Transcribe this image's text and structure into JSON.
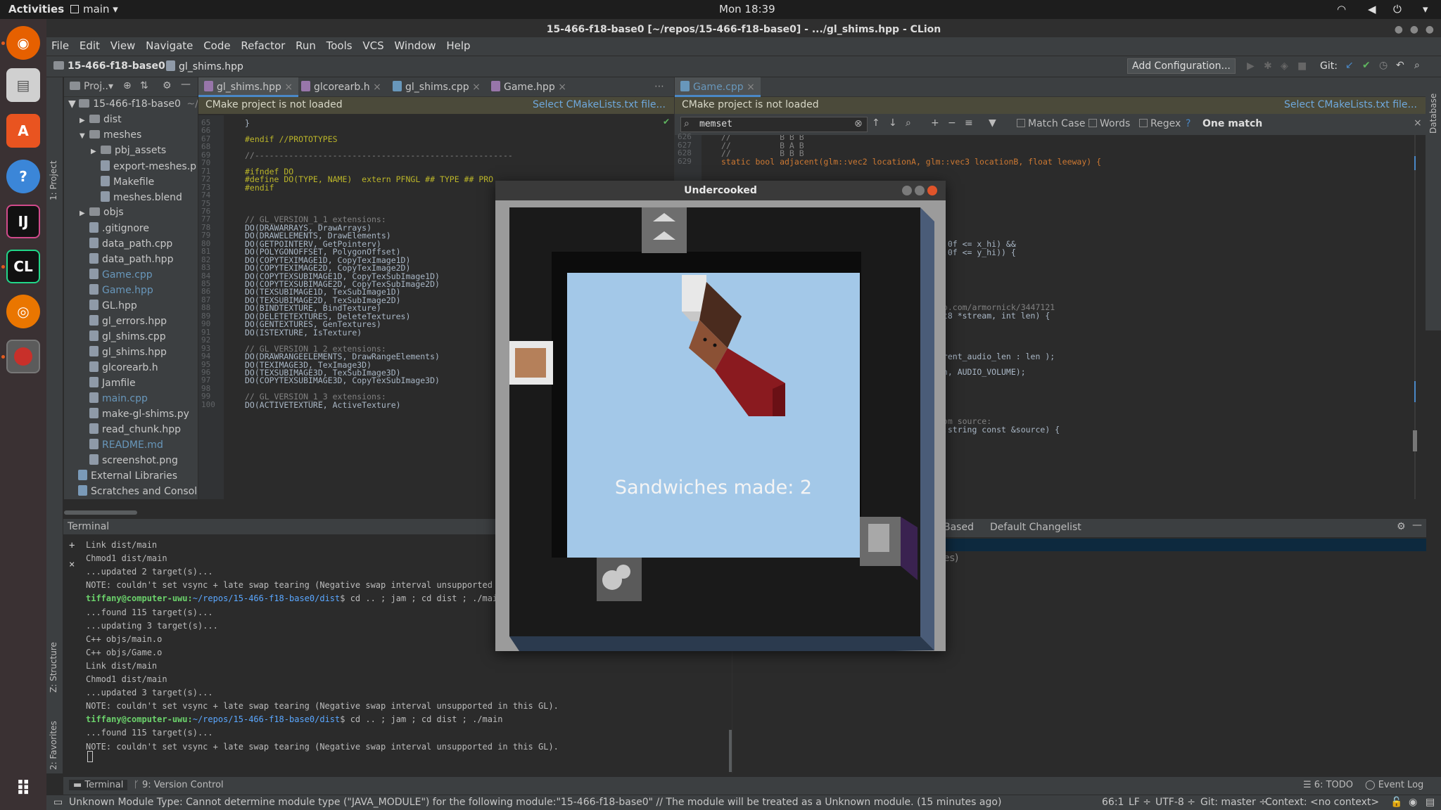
{
  "topbar": {
    "activities": "Activities",
    "app": "main ▾",
    "clock": "Mon 18:39"
  },
  "window": {
    "title": "15-466-f18-base0 [~/repos/15-466-f18-base0] - .../gl_shims.hpp - CLion"
  },
  "menu": [
    "File",
    "Edit",
    "View",
    "Navigate",
    "Code",
    "Refactor",
    "Run",
    "Tools",
    "VCS",
    "Window",
    "Help"
  ],
  "nav": {
    "project": "15-466-f18-base0",
    "file": "gl_shims.hpp",
    "add_config": "Add Configuration...",
    "git": "Git:"
  },
  "sidestrip": {
    "project": "1: Project",
    "structure": "Z: Structure",
    "favorites": "2: Favorites",
    "database": "Database"
  },
  "project_panel": {
    "header": "Proj..▾",
    "root": "15-466-f18-base0",
    "root_path": "~/re",
    "items": [
      {
        "label": "dist",
        "kind": "folder",
        "depth": 1,
        "arrow": "▶"
      },
      {
        "label": "meshes",
        "kind": "folder",
        "depth": 1,
        "arrow": "▼"
      },
      {
        "label": "pbj_assets",
        "kind": "folder",
        "depth": 2,
        "arrow": "▶"
      },
      {
        "label": "export-meshes.p",
        "kind": "file",
        "depth": 2,
        "arrow": ""
      },
      {
        "label": "Makefile",
        "kind": "file",
        "depth": 2,
        "arrow": ""
      },
      {
        "label": "meshes.blend",
        "kind": "file",
        "depth": 2,
        "arrow": ""
      },
      {
        "label": "objs",
        "kind": "folder",
        "depth": 1,
        "arrow": "▶"
      },
      {
        "label": ".gitignore",
        "kind": "file",
        "depth": 1,
        "arrow": ""
      },
      {
        "label": "data_path.cpp",
        "kind": "file",
        "depth": 1,
        "arrow": ""
      },
      {
        "label": "data_path.hpp",
        "kind": "file",
        "depth": 1,
        "arrow": ""
      },
      {
        "label": "Game.cpp",
        "kind": "file",
        "depth": 1,
        "arrow": "",
        "color": "#6897bb"
      },
      {
        "label": "Game.hpp",
        "kind": "file",
        "depth": 1,
        "arrow": "",
        "color": "#6897bb"
      },
      {
        "label": "GL.hpp",
        "kind": "file",
        "depth": 1,
        "arrow": ""
      },
      {
        "label": "gl_errors.hpp",
        "kind": "file",
        "depth": 1,
        "arrow": ""
      },
      {
        "label": "gl_shims.cpp",
        "kind": "file",
        "depth": 1,
        "arrow": ""
      },
      {
        "label": "gl_shims.hpp",
        "kind": "file",
        "depth": 1,
        "arrow": ""
      },
      {
        "label": "glcorearb.h",
        "kind": "file",
        "depth": 1,
        "arrow": ""
      },
      {
        "label": "Jamfile",
        "kind": "file",
        "depth": 1,
        "arrow": ""
      },
      {
        "label": "main.cpp",
        "kind": "file",
        "depth": 1,
        "arrow": "",
        "color": "#6897bb"
      },
      {
        "label": "make-gl-shims.py",
        "kind": "file",
        "depth": 1,
        "arrow": ""
      },
      {
        "label": "read_chunk.hpp",
        "kind": "file",
        "depth": 1,
        "arrow": ""
      },
      {
        "label": "README.md",
        "kind": "file",
        "depth": 1,
        "arrow": "",
        "color": "#6897bb"
      },
      {
        "label": "screenshot.png",
        "kind": "file",
        "depth": 1,
        "arrow": ""
      },
      {
        "label": "External Libraries",
        "kind": "lib",
        "depth": 0,
        "arrow": ""
      },
      {
        "label": "Scratches and Console",
        "kind": "lib",
        "depth": 0,
        "arrow": ""
      }
    ]
  },
  "editor_left": {
    "tabs": [
      "gl_shims.hpp",
      "glcorearb.h",
      "gl_shims.cpp",
      "Game.hpp"
    ],
    "banner": "CMake project is not loaded",
    "banner_link": "Select CMakeLists.txt file...",
    "line_numbers": [
      "65",
      "66",
      "67",
      "68",
      "69",
      "70",
      "71",
      "72",
      "73",
      "74",
      "75",
      "76",
      "77",
      "78",
      "79",
      "80",
      "81",
      "82",
      "83",
      "84",
      "85",
      "86",
      "87",
      "88",
      "89",
      "90",
      "91",
      "92",
      "93",
      "94",
      "95",
      "96",
      "97",
      "98",
      "99",
      "100"
    ],
    "lines": [
      "}",
      "",
      "#endif //PROTOTYPES",
      "",
      "//-----------------------------------------------------",
      "",
      "#ifndef DO",
      "#define DO(TYPE, NAME)  extern PFNGL ## TYPE ## PRO",
      "#endif",
      "",
      "",
      "",
      "// GL_VERSION_1_1 extensions:",
      "DO(DRAWARRAYS, DrawArrays)",
      "DO(DRAWELEMENTS, DrawElements)",
      "DO(GETPOINTERV, GetPointerv)",
      "DO(POLYGONOFFSET, PolygonOffset)",
      "DO(COPYTEXIMAGE1D, CopyTexImage1D)",
      "DO(COPYTEXIMAGE2D, CopyTexImage2D)",
      "DO(COPYTEXSUBIMAGE1D, CopyTexSubImage1D)",
      "DO(COPYTEXSUBIMAGE2D, CopyTexSubImage2D)",
      "DO(TEXSUBIMAGE1D, TexSubImage1D)",
      "DO(TEXSUBIMAGE2D, TexSubImage2D)",
      "DO(BINDTEXTURE, BindTexture)",
      "DO(DELETETEXTURES, DeleteTextures)",
      "DO(GENTEXTURES, GenTextures)",
      "DO(ISTEXTURE, IsTexture)",
      "",
      "// GL_VERSION_1_2 extensions:",
      "DO(DRAWRANGEELEMENTS, DrawRangeElements)",
      "DO(TEXIMAGE3D, TexImage3D)",
      "DO(TEXSUBIMAGE3D, TexSubImage3D)",
      "DO(COPYTEXSUBIMAGE3D, CopyTexSubImage3D)",
      "",
      "// GL_VERSION_1_3 extensions:",
      "DO(ACTIVETEXTURE, ActiveTexture)"
    ]
  },
  "editor_right": {
    "tab": "Game.cpp",
    "banner": "CMake project is not loaded",
    "banner_link": "Select CMakeLists.txt file...",
    "search_value": "memset",
    "match_case": "Match Case",
    "words": "Words",
    "regex": "Regex",
    "help": "?",
    "result": "One match",
    "line_numbers": [
      "626",
      "627",
      "628",
      "629"
    ],
    "lines": [
      "//          B B B",
      "//          B A B",
      "//          B B B",
      "static bool adjacent(glm::vec2 locationA, glm::vec3 locationB, float leeway) {"
    ],
    "fragments": [
      "1.0f <= x_hi) &&",
      "1.0f <= y_hi)) {",
      "ub.com/armornick/3447121",
      "nt8 *stream, int len) {",
      "rrent_audio_len : len );",
      "en, AUDIO_VOLUME);",
      "rom source:",
      "::string const &source) {"
    ]
  },
  "vcs_panel": {
    "tab_based": "Based",
    "tab_changelist": "Default Changelist",
    "fragment": "es)"
  },
  "terminal": {
    "title": "Terminal",
    "lines": [
      {
        "text": "Link dist/main"
      },
      {
        "text": "Chmod1 dist/main"
      },
      {
        "text": "...updated 2 target(s)..."
      },
      {
        "text": "NOTE: couldn't set vsync + late swap tearing (Negative swap interval unsupported in"
      },
      {
        "prompt": "tiffany@computer-uwu",
        "path": "~/repos/15-466-f18-base0/dist",
        "cmd": "$ cd .. ; jam ; cd dist ; ./main"
      },
      {
        "text": "...found 115 target(s)..."
      },
      {
        "text": "...updating 3 target(s)..."
      },
      {
        "text": "C++ objs/main.o"
      },
      {
        "text": "C++ objs/Game.o"
      },
      {
        "text": "Link dist/main"
      },
      {
        "text": "Chmod1 dist/main"
      },
      {
        "text": "...updated 3 target(s)..."
      },
      {
        "text": "NOTE: couldn't set vsync + late swap tearing (Negative swap interval unsupported in this GL)."
      },
      {
        "prompt": "tiffany@computer-uwu",
        "path": "~/repos/15-466-f18-base0/dist",
        "cmd": "$ cd .. ; jam ; cd dist ; ./main"
      },
      {
        "text": "...found 115 target(s)..."
      },
      {
        "text": "NOTE: couldn't set vsync + late swap tearing (Negative swap interval unsupported in this GL)."
      }
    ]
  },
  "game": {
    "title": "Undercooked",
    "score_text": "Sandwiches made: 2"
  },
  "bottom_tools": {
    "terminal": "Terminal",
    "vcs": "9: Version Control",
    "todo": "6: TODO",
    "event_log": "Event Log"
  },
  "status": {
    "message": "Unknown Module Type: Cannot determine module type (\"JAVA_MODULE\") for the following module:\"15-466-f18-base0\" // The module will be treated as a Unknown module. (15 minutes ago)",
    "position": "66:1",
    "line_sep": "LF ÷",
    "encoding": "UTF-8 ÷",
    "git": "Git: master ÷",
    "context": "Context: <no context>"
  },
  "colors": {
    "accent": "#4a88c7",
    "ide_bg": "#2b2b2b",
    "panel": "#3c3f41",
    "sky": "#a3c8e8"
  }
}
